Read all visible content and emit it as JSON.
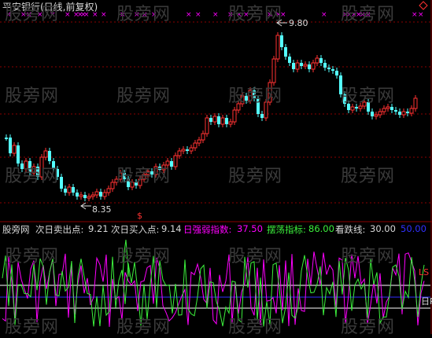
{
  "title": "平安银行(日线,前复权)",
  "watermark": "股旁网",
  "price_annotations": {
    "high": "9.80",
    "low": "8.35"
  },
  "indicator": {
    "name": "股旁网",
    "sell_label": "次日卖出点:",
    "sell_value": "9.21",
    "buy_label": "次日买入点:",
    "buy_value": "9.14",
    "strength_label": "日强弱指数:",
    "strength_value": "37.50",
    "swing_label": "摆荡指标:",
    "swing_value": "86.00",
    "fall_label": "看跌线:",
    "fall_value": "30.00",
    "extra_value": "50.00"
  },
  "side_labels": {
    "ls": "LS",
    "ri": "日R"
  },
  "colors": {
    "up": "#ff3232",
    "down": "#54ffff",
    "grid": "#8b0000",
    "magenta": "#ff00ff",
    "green": "#3cf03c",
    "white": "#ffffff",
    "blue": "#3030ff"
  }
}
